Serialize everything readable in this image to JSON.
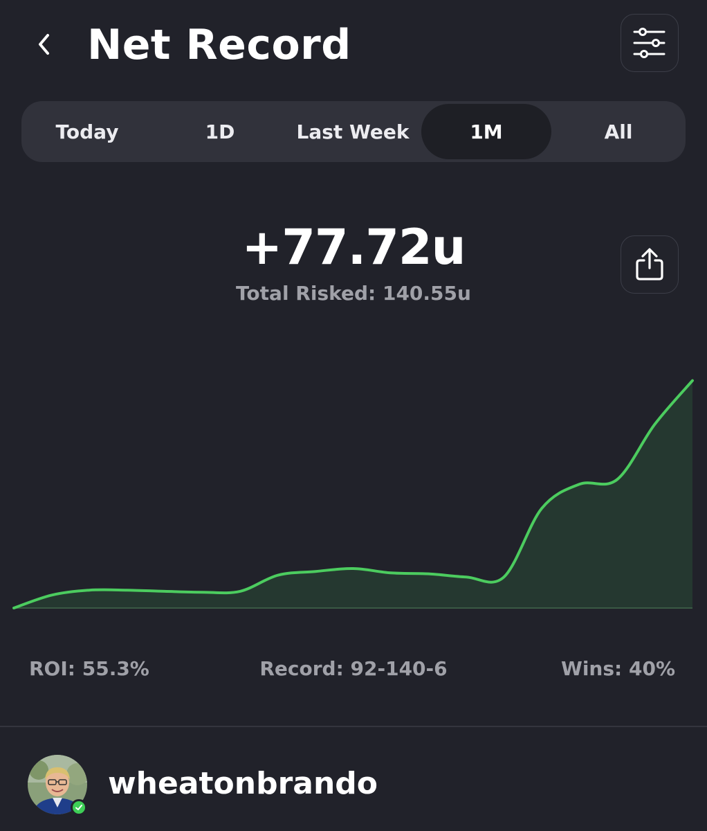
{
  "header": {
    "title": "Net Record",
    "back_icon": "chevron-left-icon",
    "filter_icon": "sliders-icon"
  },
  "tabs": [
    {
      "label": "Today",
      "active": false
    },
    {
      "label": "1D",
      "active": false
    },
    {
      "label": "Last Week",
      "active": false
    },
    {
      "label": "1M",
      "active": true
    },
    {
      "label": "All",
      "active": false
    }
  ],
  "summary": {
    "net": "+77.72u",
    "total_risked": "Total Risked: 140.55u",
    "share_icon": "share-icon"
  },
  "chart_data": {
    "type": "area",
    "title": "",
    "xlabel": "",
    "ylabel": "",
    "line_color": "#4ccc5f",
    "fill_color": "#253830",
    "values": [
      0,
      4.4,
      6.1,
      6.1,
      5.7,
      5.4,
      5.7,
      11.2,
      12.5,
      13.5,
      12.0,
      11.7,
      10.6,
      10.6,
      34.0,
      42.3,
      43.9,
      62.8,
      77.72
    ],
    "ylim": [
      -1,
      80
    ],
    "grid": false
  },
  "stats": {
    "roi": "ROI: 55.3%",
    "record": "Record: 92-140-6",
    "wins": "Wins: 40%"
  },
  "user": {
    "username": "wheatonbrando",
    "avatar_icon": "avatar",
    "verified_icon": "check-badge-icon",
    "accent": "#3ecf57"
  }
}
